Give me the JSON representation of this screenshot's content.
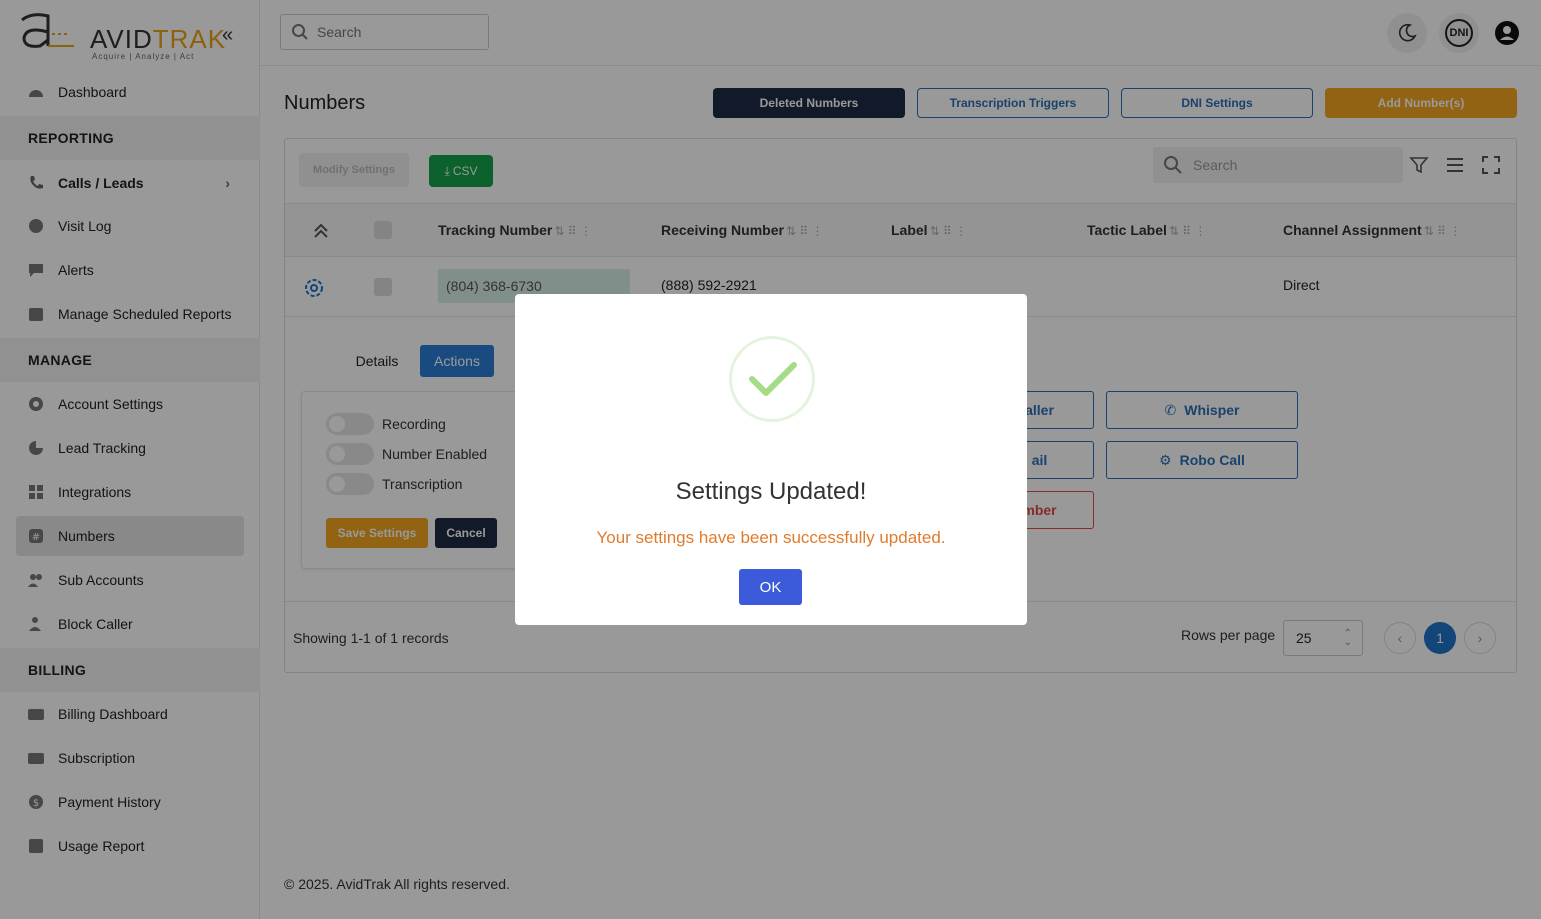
{
  "brand": {
    "logo_mark": "a",
    "logo_text_plain": "AVID",
    "logo_text_accent": "TRAK",
    "tagline": "Acquire  |  Analyze  |  Act"
  },
  "sidebar": {
    "items": [
      {
        "id": "dashboard",
        "label": "Dashboard",
        "icon": "dashboard-icon"
      },
      {
        "section": "REPORTING"
      },
      {
        "id": "calls-leads",
        "label": "Calls / Leads",
        "icon": "phone-icon"
      },
      {
        "id": "visit-log",
        "label": "Visit Log",
        "icon": "globe-icon"
      },
      {
        "id": "alerts",
        "label": "Alerts",
        "icon": "chat-icon"
      },
      {
        "id": "reports",
        "label": "Manage Scheduled Reports",
        "icon": "calendar-icon"
      },
      {
        "section": "MANAGE"
      },
      {
        "id": "account-settings",
        "label": "Account Settings",
        "icon": "gear-icon"
      },
      {
        "id": "lead-tracking",
        "label": "Lead Tracking",
        "icon": "pie-icon"
      },
      {
        "id": "integrations",
        "label": "Integrations",
        "icon": "grid-icon"
      },
      {
        "id": "numbers",
        "label": "Numbers",
        "icon": "hash-icon"
      },
      {
        "id": "sub-accounts",
        "label": "Sub Accounts",
        "icon": "users-icon"
      },
      {
        "id": "block-caller",
        "label": "Block Caller",
        "icon": "user-block-icon"
      },
      {
        "section": "BILLING"
      },
      {
        "id": "billing-dashboard",
        "label": "Billing Dashboard",
        "icon": "card-icon"
      },
      {
        "id": "subscription",
        "label": "Subscription",
        "icon": "card-icon"
      },
      {
        "id": "payment-history",
        "label": "Payment History",
        "icon": "dollar-icon"
      },
      {
        "id": "usage-report",
        "label": "Usage Report",
        "icon": "list-icon"
      }
    ],
    "sections": {
      "reporting": "REPORTING",
      "manage": "MANAGE",
      "billing": "BILLING"
    },
    "labels": {
      "dashboard": "Dashboard",
      "calls_leads": "Calls / Leads",
      "visit_log": "Visit Log",
      "alerts": "Alerts",
      "reports": "Manage Scheduled Reports",
      "account_settings": "Account Settings",
      "lead_tracking": "Lead Tracking",
      "integrations": "Integrations",
      "numbers": "Numbers",
      "sub_accounts": "Sub Accounts",
      "block_caller": "Block Caller",
      "billing_dashboard": "Billing Dashboard",
      "subscription": "Subscription",
      "payment_history": "Payment History",
      "usage_report": "Usage Report"
    },
    "active": "Numbers"
  },
  "header": {
    "search_placeholder": "Search",
    "dni_badge": "DNI"
  },
  "page": {
    "title": "Numbers",
    "buttons": {
      "deleted": "Deleted Numbers",
      "triggers": "Transcription Triggers",
      "dni_settings": "DNI Settings",
      "add": "Add Number(s)"
    }
  },
  "table": {
    "modify_settings": "Modify Settings",
    "csv": "CSV",
    "search_placeholder": "Search",
    "columns": {
      "tracking": "Tracking Number",
      "receiving": "Receiving Number",
      "label": "Label",
      "tactic": "Tactic Label",
      "channel": "Channel Assignment"
    },
    "rows": [
      {
        "tracking": "(804) 368-6730",
        "receiving": "(888) 592-2921",
        "label": "",
        "tactic": "",
        "channel": "Direct"
      }
    ],
    "expanded": {
      "tabs": {
        "details": "Details",
        "actions": "Actions"
      },
      "active_tab": "Actions",
      "toggles": {
        "recording": "Recording",
        "number_enabled": "Number Enabled",
        "transcription": "Transcription"
      },
      "save": "Save Settings",
      "cancel": "Cancel",
      "actions": {
        "caller": "aller",
        "whisper": "Whisper",
        "mail": "ail",
        "robo_call": "Robo Call",
        "number": "mber"
      }
    },
    "footer": {
      "showing": "Showing 1-1 of 1 records",
      "rows_per_page_label": "Rows per page",
      "rows_per_page": "25",
      "current_page": "1"
    }
  },
  "footer": {
    "copyright": "© 2025. AvidTrak All rights reserved."
  },
  "modal": {
    "title": "Settings Updated!",
    "message": "Your settings have been successfully updated.",
    "ok": "OK"
  },
  "colors": {
    "accent_orange": "#f2a51f",
    "dark_navy": "#1f2a44",
    "link_blue": "#2c6fb5",
    "success_green": "#15a34a",
    "message_orange": "#e07b2c",
    "ok_blue": "#3b5bdb"
  }
}
